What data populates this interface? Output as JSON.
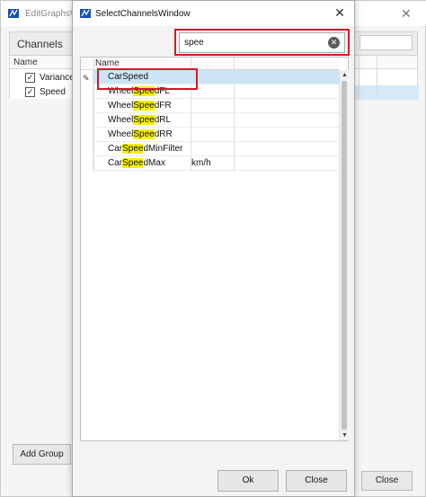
{
  "background_window": {
    "title": "EditGraphsW",
    "close_glyph": "✕",
    "groupbox_label": "Channels",
    "table_header": "Name",
    "rows": [
      {
        "label": "Variance",
        "checked": true
      },
      {
        "label": "Speed",
        "checked": true
      }
    ],
    "add_group_label": "Add Group",
    "close_label": "Close"
  },
  "dialog": {
    "title": "SelectChannelsWindow",
    "close_glyph": "✕",
    "search": {
      "value": "spee",
      "clear_glyph": "✕"
    },
    "grid": {
      "header_name": "Name",
      "rows": [
        {
          "pre": "CarSpeed",
          "hl": "",
          "post": "",
          "unit": "",
          "selected": true
        },
        {
          "pre": "Wheel",
          "hl": "Spee",
          "post": "dFL",
          "unit": ""
        },
        {
          "pre": "Wheel",
          "hl": "Spee",
          "post": "dFR",
          "unit": ""
        },
        {
          "pre": "Wheel",
          "hl": "Spee",
          "post": "dRL",
          "unit": ""
        },
        {
          "pre": "Wheel",
          "hl": "Spee",
          "post": "dRR",
          "unit": ""
        },
        {
          "pre": "Car",
          "hl": "Spee",
          "post": "dMinFilter",
          "unit": ""
        },
        {
          "pre": "Car",
          "hl": "Spee",
          "post": "dMax",
          "unit": "km/h"
        }
      ]
    },
    "ok_label": "Ok",
    "close_label": "Close"
  },
  "icons": {
    "app_icon": "app-logo-icon",
    "edit_pen": "pencil-icon",
    "scroll_up": "▲",
    "scroll_down": "▼"
  },
  "colors": {
    "highlight_yellow": "#f7f000",
    "annotation_red": "#d11a2a",
    "selection_blue": "#cde4f6"
  }
}
